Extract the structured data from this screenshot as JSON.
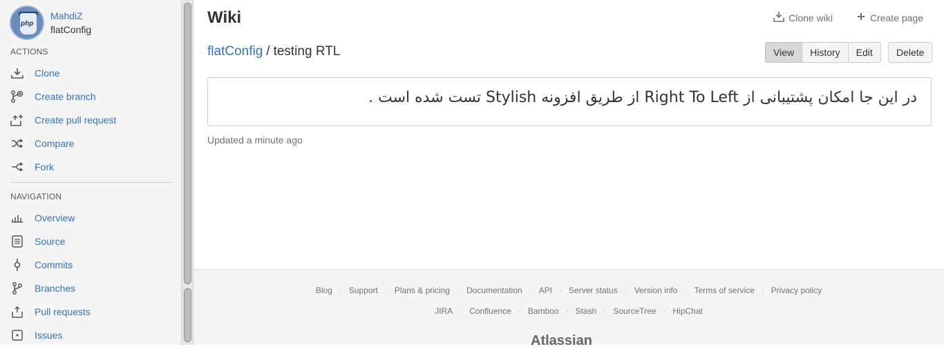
{
  "repo": {
    "owner": "MahdiZ",
    "name": "flatConfig",
    "avatar_icon": "php-avatar"
  },
  "actions": {
    "title": "ACTIONS",
    "items": [
      {
        "label": "Clone",
        "icon": "download-icon"
      },
      {
        "label": "Create branch",
        "icon": "create-branch-icon"
      },
      {
        "label": "Create pull request",
        "icon": "create-pull-request-icon"
      },
      {
        "label": "Compare",
        "icon": "compare-icon"
      },
      {
        "label": "Fork",
        "icon": "fork-icon"
      }
    ]
  },
  "navigation": {
    "title": "NAVIGATION",
    "items": [
      {
        "label": "Overview",
        "icon": "overview-icon"
      },
      {
        "label": "Source",
        "icon": "source-icon"
      },
      {
        "label": "Commits",
        "icon": "commits-icon"
      },
      {
        "label": "Branches",
        "icon": "branches-icon"
      },
      {
        "label": "Pull requests",
        "icon": "pull-requests-icon"
      },
      {
        "label": "Issues",
        "icon": "issues-icon"
      }
    ]
  },
  "page": {
    "title": "Wiki",
    "clone_wiki": "Clone wiki",
    "create_page": "Create page",
    "breadcrumb": {
      "repo": "flatConfig",
      "separator": "/",
      "current": "testing RTL"
    },
    "buttons": {
      "view": "View",
      "history": "History",
      "edit": "Edit",
      "delete": "Delete"
    },
    "content": "در این جا امکان پشتیبانی از Right To Left از طریق افزونه Stylish تست شده است .",
    "updated": "Updated a minute ago"
  },
  "footer": {
    "row1": [
      "Blog",
      "Support",
      "Plans & pricing",
      "Documentation",
      "API",
      "Server status",
      "Version info",
      "Terms of service",
      "Privacy policy"
    ],
    "row2": [
      "JIRA",
      "Confluence",
      "Bamboo",
      "Stash",
      "SourceTree",
      "HipChat"
    ],
    "brand": "Atlassian"
  },
  "colors": {
    "link": "#3572b0",
    "muted": "#707070",
    "sidebar_bg": "#f5f5f5"
  }
}
